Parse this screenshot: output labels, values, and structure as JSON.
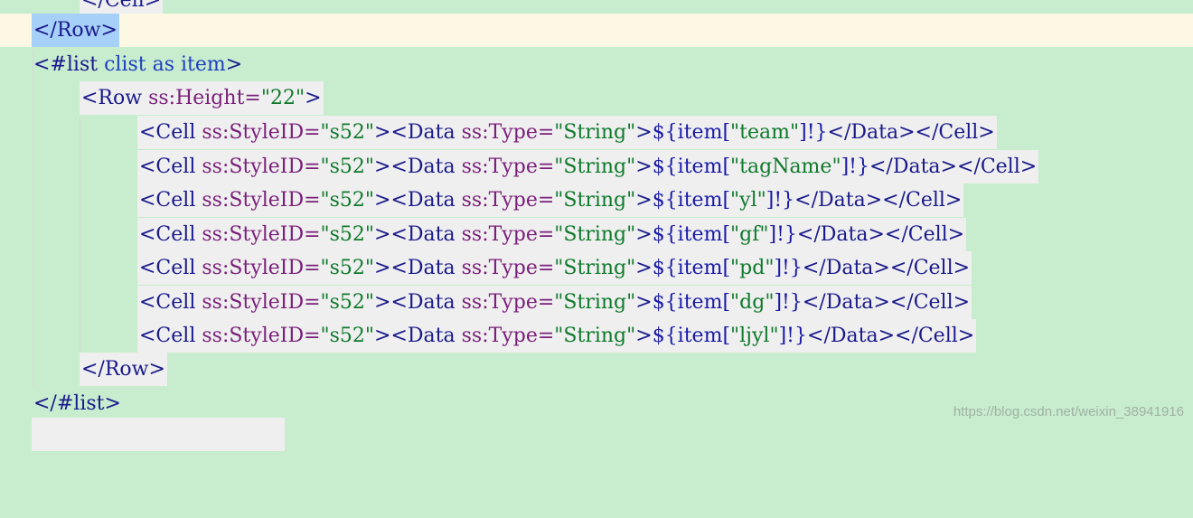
{
  "lines": {
    "l0": "</Cell>",
    "l1": "</Row>",
    "l2_open": "<#list",
    "l2_kw1": "clist",
    "l2_kw2": "as",
    "l2_kw3": "item",
    "l2_close": ">",
    "l3_tag": "<Row",
    "l3_attr": "ss:Height=",
    "l3_val": "\"22\"",
    "l3_close": ">",
    "cell_open": "<Cell",
    "cell_attr": "ss:StyleID=",
    "cell_val": "\"s52\"",
    "data_open": "><Data",
    "data_attr": "ss:Type=",
    "data_val": "\"String\"",
    "data_close": ">",
    "expr_pre": "${item[",
    "expr_post": "]!}",
    "tail": "</Data></Cell>",
    "keys": [
      "\"team\"",
      "\"tagName\"",
      "\"yl\"",
      "\"gf\"",
      "\"pd\"",
      "\"dg\"",
      "\"ljyl\""
    ],
    "l11": "</Row>",
    "l12": "</#list>"
  },
  "watermark": "https://blog.csdn.net/weixin_38941916"
}
